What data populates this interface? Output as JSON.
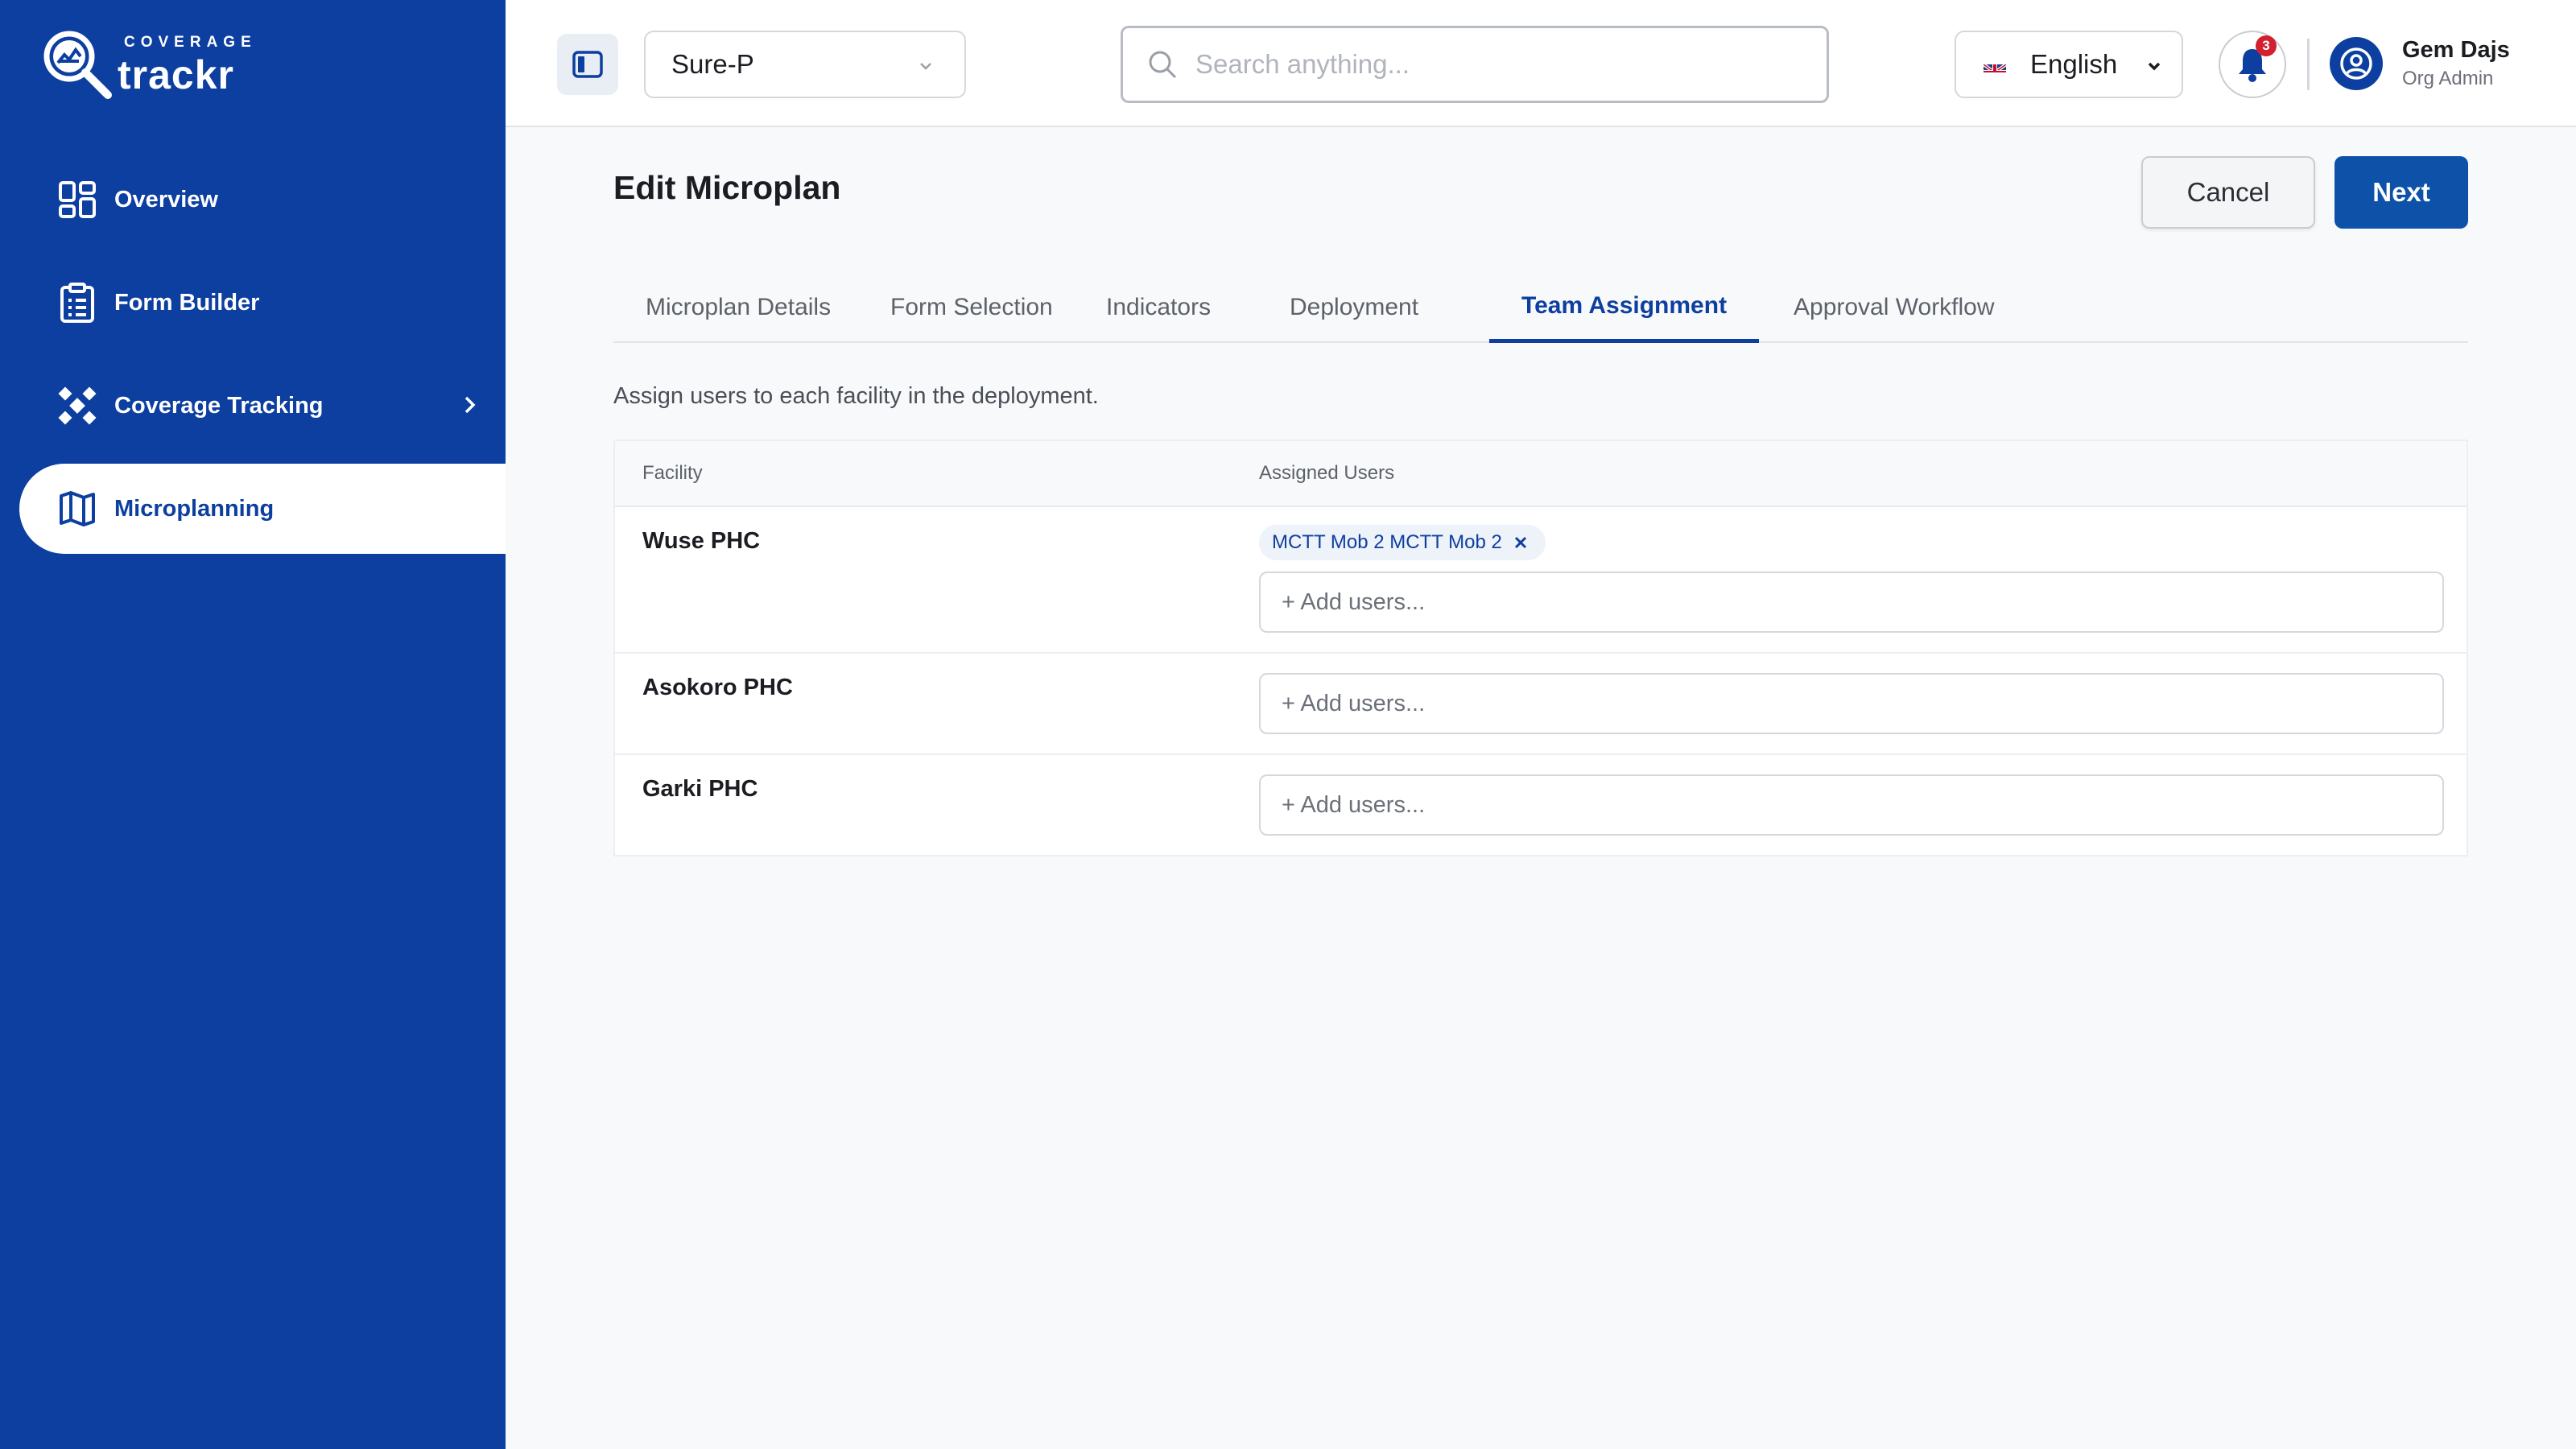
{
  "brand": {
    "top": "COVERAGE",
    "main": "trackr"
  },
  "sidebar": {
    "items": [
      {
        "label": "Overview",
        "icon": "dashboard-icon"
      },
      {
        "label": "Form Builder",
        "icon": "clipboard-icon"
      },
      {
        "label": "Coverage Tracking",
        "icon": "satellite-icon"
      },
      {
        "label": "Microplanning",
        "icon": "map-icon"
      }
    ]
  },
  "header": {
    "project": "Sure-P",
    "search_placeholder": "Search anything...",
    "language": "English",
    "notifications": "3",
    "user_name": "Gem Dajs",
    "user_role": "Org Admin"
  },
  "page": {
    "title": "Edit Microplan",
    "cancel_label": "Cancel",
    "next_label": "Next",
    "description": "Assign users to each facility in the deployment."
  },
  "tabs": [
    {
      "label": "Microplan Details"
    },
    {
      "label": "Form Selection"
    },
    {
      "label": "Indicators"
    },
    {
      "label": "Deployment"
    },
    {
      "label": "Team Assignment"
    },
    {
      "label": "Approval Workflow"
    }
  ],
  "table": {
    "headers": {
      "facility": "Facility",
      "users": "Assigned Users"
    },
    "add_placeholder": "+ Add users...",
    "rows": [
      {
        "facility": "Wuse PHC",
        "assigned": [
          "MCTT Mob 2 MCTT Mob 2"
        ]
      },
      {
        "facility": "Asokoro PHC",
        "assigned": []
      },
      {
        "facility": "Garki PHC",
        "assigned": []
      }
    ]
  },
  "colors": {
    "primary": "#0d3fa0",
    "button": "#0d52a8",
    "badge": "#d22030"
  }
}
